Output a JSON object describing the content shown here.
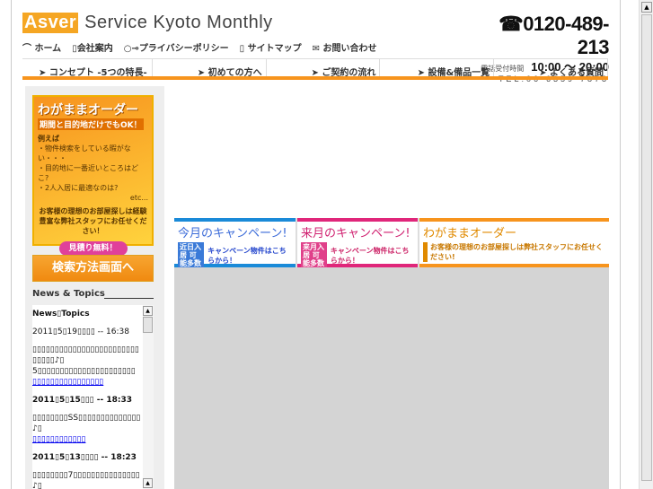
{
  "header": {
    "logo": [
      "Asver",
      "Service",
      "Kyoto",
      "Monthly"
    ],
    "top_links": [
      "ホーム",
      "会社案内",
      "プライバシーポリシー",
      "サイトマップ",
      "お問い合わせ"
    ],
    "phone": "0120-489-213",
    "hours_label": "電話受付時間",
    "hours": "10:00 〜 20:00",
    "tel": "TEL:06-6359-7878"
  },
  "nav": [
    "コンセプト -5つの特長-",
    "初めての方へ",
    "ご契約の流れ",
    "設備&備品一覧",
    "よくある質問"
  ],
  "promo": {
    "title": "わがままオーダー",
    "subtitle": "期間と目的地だけでもOK！",
    "example": "例えば",
    "lines": [
      "・物件検索をしている暇がない・・・",
      "・目的地に一番近いところはどこ?",
      "・2人入居に最適なのは?"
    ],
    "etc": "etc...",
    "message": "お客様の理想のお部屋探しは経験豊富な弊社スタッフにお任せください！",
    "button": "見積り無料！"
  },
  "search_button": "検索方法画面へ",
  "news": {
    "section_title": "News & Topics",
    "heading": "News▯Topics",
    "items": [
      {
        "date": "2011▯5▯19▯▯▯▯ -- 16:38",
        "text": "▯▯▯▯▯▯▯▯▯▯▯▯▯▯▯▯▯▯▯▯▯▯▯▯▯▯▯▯▯♪▯",
        "text2": "5▯▯▯▯▯▯▯▯▯▯▯▯▯▯▯▯▯▯▯▯▯▯",
        "link": "▯▯▯▯▯▯▯▯▯▯▯▯▯▯▯▯"
      },
      {
        "date": "2011▯5▯15▯▯▯ -- 18:33",
        "text": "▯▯▯▯▯▯▯▯SS▯▯▯▯▯▯▯▯▯▯▯▯▯▯♪▯",
        "link": "▯▯▯▯▯▯▯▯▯▯▯▯"
      },
      {
        "date": "2011▯5▯13▯▯▯▯ -- 18:23",
        "text": "▯▯▯▯▯▯▯▯7▯▯▯▯▯▯▯▯▯▯▯▯▯▯▯♪▯"
      }
    ]
  },
  "banners": [
    {
      "title": "今月のキャンペーン!",
      "tag": "近日入居 可能多数",
      "text": "キャンペーン物件はこちらから！",
      "color": "#1a8ad8",
      "tagcolor": "#3a7ad8",
      "textcolor": "#2244cc"
    },
    {
      "title": "来月のキャンペーン!",
      "tag": "来月入居 可能多数",
      "text": "キャンペーン物件はこちらから！",
      "color": "#e0267a",
      "tagcolor": "#e0408a",
      "textcolor": "#cc2266"
    },
    {
      "title": "わがままオーダー",
      "text": "お客様の理想のお部屋探しは弊社スタッフにお任せください!",
      "color": "#f7941d",
      "textcolor": "#c87800"
    }
  ]
}
